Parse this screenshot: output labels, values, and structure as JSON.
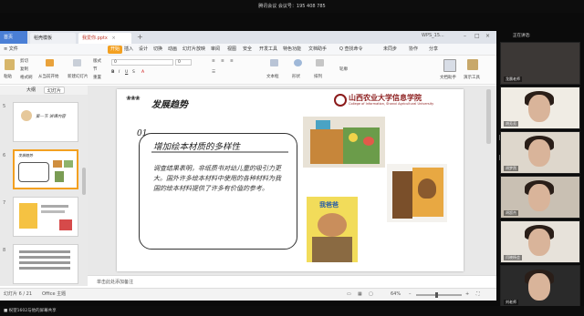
{
  "meeting": {
    "title": "腾讯会议 会议号：195 408 785",
    "share_notice": "■ 祝望1602与他的屏幕共享",
    "video_header": "正在讲话:",
    "participants": [
      {
        "name": "龙晨老师",
        "bg": "#3c3836"
      },
      {
        "name": "胡芳芳",
        "bg": "#f0ece4"
      },
      {
        "name": "胡梦然",
        "bg": "#ded7cc"
      },
      {
        "name": "胡超杰",
        "bg": "#c9c0b3"
      },
      {
        "name": "闫晓杨会",
        "bg": "#e7e2da"
      },
      {
        "name": "刘老师",
        "bg": "#2a2a2a"
      }
    ]
  },
  "wps": {
    "tabs": {
      "home": "首页",
      "template": "稻壳模板",
      "doc": "我爱你.pptx"
    },
    "window_title_right": "WPS_15...",
    "menu": {
      "file": "≡ 文件",
      "start": "开始",
      "insert": "插入",
      "design": "设计",
      "switch": "切换",
      "animation": "动画",
      "slideshow": "幻灯片放映",
      "review": "审阅",
      "view": "视图",
      "security": "安全",
      "dev": "开发工具",
      "special": "特色功能",
      "docassist": "文档助手",
      "search": "Q 查找命令",
      "sync": "未同步",
      "collab": "协作",
      "share": "分享"
    },
    "ribbon": {
      "paste": "粘贴",
      "cut": "剪切",
      "copy": "复制",
      "format_painter": "格式刷",
      "from_current": "从当前开始",
      "new_slide": "新建幻灯片",
      "layout": "版式",
      "section": "节",
      "reset": "重置",
      "font_value": "0",
      "font_size": "0",
      "textbox": "文本框",
      "shape": "形状",
      "arrange": "排列",
      "outline": "轮廓",
      "doc_assist": "文档助手",
      "tools": "演示工具"
    },
    "panel_tabs": {
      "outline": "大纲",
      "slides": "幻灯片"
    },
    "thumbnails": [
      {
        "num": "5",
        "text": "第一节 讲课内容"
      },
      {
        "num": "6",
        "text": "发展趋势"
      },
      {
        "num": "7",
        "text": ""
      },
      {
        "num": "8",
        "text": ""
      }
    ],
    "notes_placeholder": "单击此处添加备注",
    "status": {
      "slide_count": "幻灯片 6 / 21",
      "theme": "Office 主题",
      "zoom": "64%",
      "zoom_fraction": 0.45
    },
    "slide": {
      "deco": "❀❀❀",
      "title": "发展趋势",
      "logo_name": "山西农业大学信息学院",
      "logo_sub": "College of Information, Shanxi Agricultural University",
      "number": "01",
      "heading": "增加绘本材质的多样性",
      "body": "调查结果表明，非纸质书对幼儿童的吸引力更大。国外许多绘本材料中使用的各种材料为我国的绘本材料提供了许多有价值的参考。",
      "book_title": "我爸爸"
    }
  },
  "colors": {
    "accent": "#f3a020",
    "home_tab": "#4a7fd6",
    "logo_red": "#8b1b1b"
  }
}
